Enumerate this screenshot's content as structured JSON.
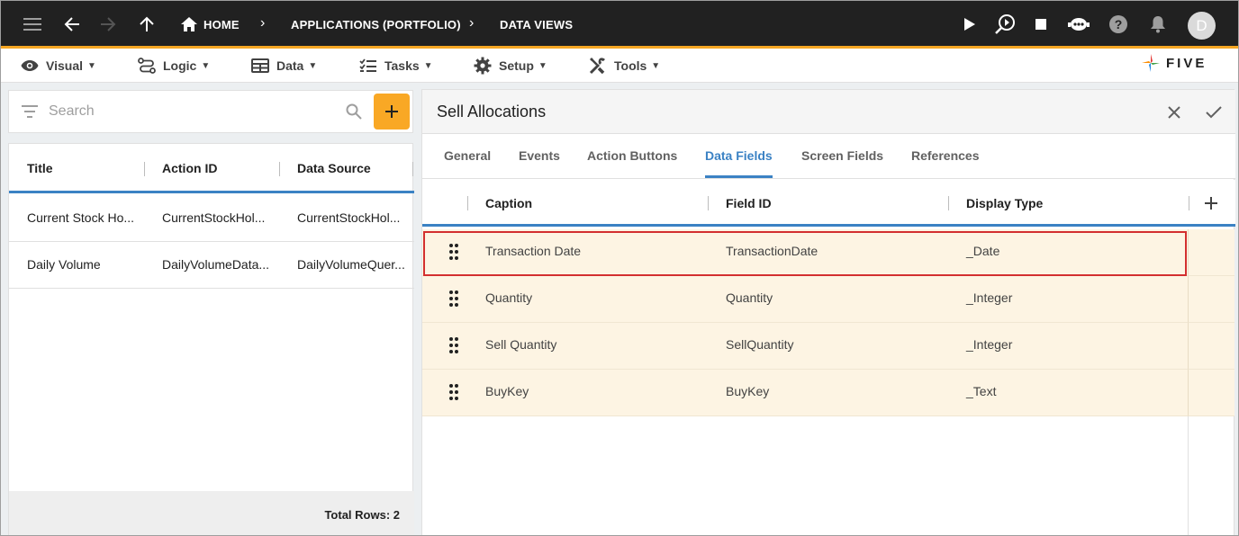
{
  "appbar": {
    "breadcrumbs": [
      "HOME",
      "APPLICATIONS (PORTFOLIO)",
      "DATA VIEWS"
    ],
    "avatar_letter": "D"
  },
  "menubar": {
    "items": [
      {
        "label": "Visual",
        "icon": "eye-icon"
      },
      {
        "label": "Logic",
        "icon": "logic-icon"
      },
      {
        "label": "Data",
        "icon": "table-icon"
      },
      {
        "label": "Tasks",
        "icon": "tasks-icon"
      },
      {
        "label": "Setup",
        "icon": "gear-icon"
      },
      {
        "label": "Tools",
        "icon": "tools-icon"
      }
    ],
    "logo_text": "FIVE"
  },
  "left": {
    "search_placeholder": "Search",
    "columns": [
      "Title",
      "Action ID",
      "Data Source"
    ],
    "rows": [
      [
        "Current Stock Ho...",
        "CurrentStockHol...",
        "CurrentStockHol..."
      ],
      [
        "Daily Volume",
        "DailyVolumeData...",
        "DailyVolumeQuer..."
      ]
    ],
    "footer": "Total Rows: 2"
  },
  "right": {
    "title": "Sell Allocations",
    "tabs": [
      "General",
      "Events",
      "Action Buttons",
      "Data Fields",
      "Screen Fields",
      "References"
    ],
    "active_tab": "Data Fields",
    "columns": [
      "Caption",
      "Field ID",
      "Display Type"
    ],
    "rows": [
      [
        "Transaction Date",
        "TransactionDate",
        "_Date"
      ],
      [
        "Quantity",
        "Quantity",
        "_Integer"
      ],
      [
        "Sell Quantity",
        "SellQuantity",
        "_Integer"
      ],
      [
        "BuyKey",
        "BuyKey",
        "_Text"
      ]
    ]
  },
  "colors": {
    "accent": "#3b82c4",
    "appbar": "#212121",
    "appbar_border": "#f5a623",
    "add_button": "#f9a825",
    "row_highlight": "#fdf4e3",
    "selection_outline": "#d32f2f"
  }
}
